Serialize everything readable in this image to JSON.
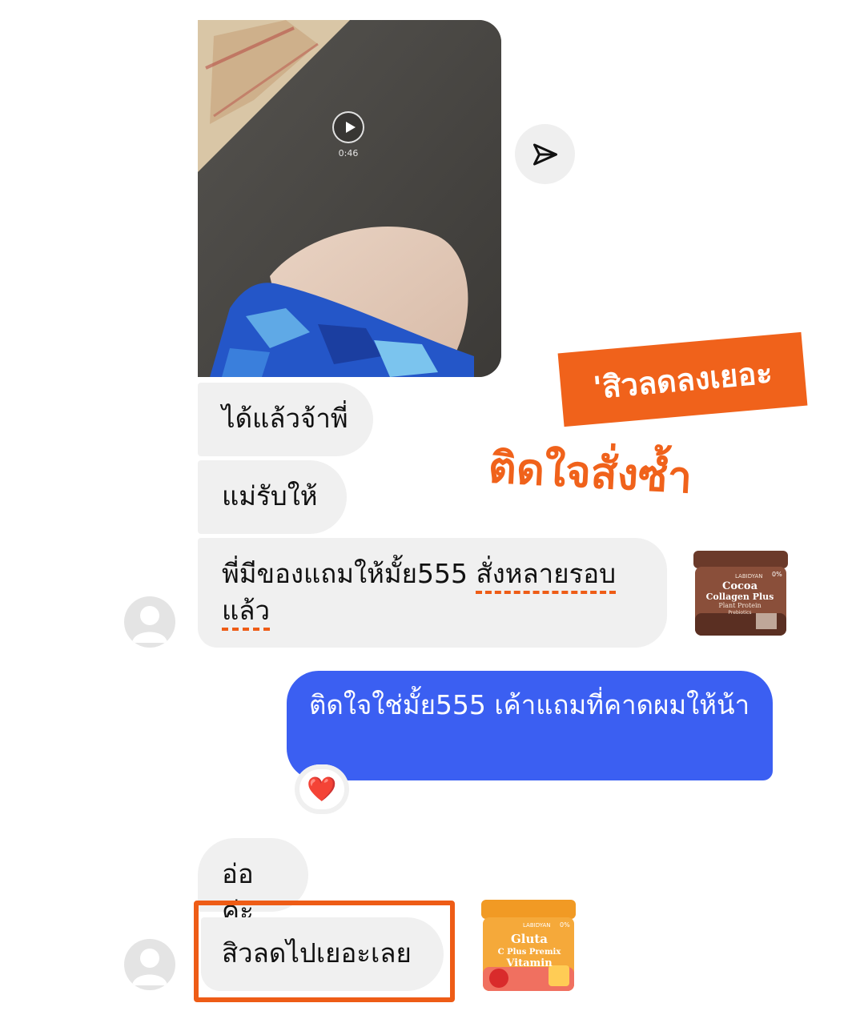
{
  "video": {
    "duration": "0:46"
  },
  "messages": {
    "m1": "ได้แล้วจ้าพี่",
    "m2": "แม่รับให้",
    "m3_a": "พี่มีของแถมให้มั้ย555 ",
    "m3_b": "สั่งหลายรอบ",
    "m3_c": "แล้ว",
    "m4": "ติดใจใช่มั้ย555 เค้าแถมที่คาดผมให้น้า",
    "m4_reaction": "❤️",
    "m5": "อ่อค่ะ",
    "m6": "สิวลดไปเยอะเลย"
  },
  "annotations": {
    "tag": "'สิวลดลงเยอะ",
    "handwritten": "ติดใจสั่งซ้ำ"
  },
  "products": {
    "cocoa": {
      "brand": "LABIDYAN",
      "line1": "Cocoa",
      "line2": "Collagen Plus",
      "line3": "Plant Protein",
      "line4": "Prebiotics",
      "badge": "0%"
    },
    "gluta": {
      "brand": "LABIDYAN",
      "line1": "Gluta",
      "line2": "C Plus Premix",
      "line3": "Vitamin",
      "badge": "0%"
    }
  },
  "colors": {
    "accent_orange": "#f0621b",
    "sent_bubble": "#3b5ff2",
    "received_bubble": "#f0f0f0"
  }
}
